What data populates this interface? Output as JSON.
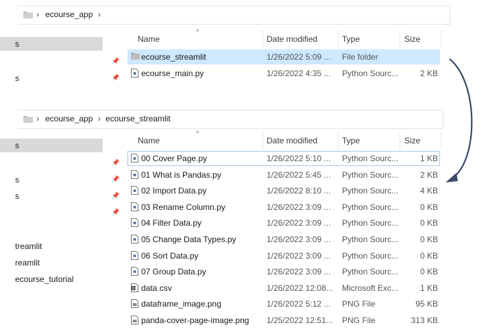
{
  "top": {
    "breadcrumb": [
      "ecourse_app"
    ],
    "columns": {
      "name": "Name",
      "date": "Date modified",
      "type": "Type",
      "size": "Size"
    },
    "sidebar": [
      {
        "label": "s",
        "selected": true
      },
      {
        "label": "",
        "pinned": true
      },
      {
        "label": "s",
        "pinned": true
      }
    ],
    "files": [
      {
        "name": "ecourse_streamlit",
        "date": "1/26/2022 5:09 ...",
        "type": "File folder",
        "size": "",
        "icon": "folder-icon",
        "selected": true
      },
      {
        "name": "ecourse_main.py",
        "date": "1/26/2022 4:35 ...",
        "type": "Python Sourc...",
        "size": "2 KB",
        "icon": "python-file-icon"
      }
    ]
  },
  "bottom": {
    "breadcrumb": [
      "ecourse_app",
      "ecourse_streamlit"
    ],
    "columns": {
      "name": "Name",
      "date": "Date modified",
      "type": "Type",
      "size": "Size"
    },
    "sidebar": [
      {
        "label": "s",
        "selected": true
      },
      {
        "label": "",
        "pinned": true
      },
      {
        "label": "s",
        "pinned": true
      },
      {
        "label": "s",
        "pinned": true
      },
      {
        "label": "",
        "pinned": true
      },
      {
        "label": ""
      },
      {
        "label": "treamlit"
      },
      {
        "label": "reamlit"
      },
      {
        "label": "ecourse_tutorial"
      }
    ],
    "files": [
      {
        "name": "00 Cover Page.py",
        "date": "1/26/2022 5:10 ...",
        "type": "Python Sourc...",
        "size": "1 KB",
        "icon": "python-file-icon",
        "focused": true
      },
      {
        "name": "01 What is Pandas.py",
        "date": "1/26/2022 5:45 ...",
        "type": "Python Sourc...",
        "size": "2 KB",
        "icon": "python-file-icon"
      },
      {
        "name": "02 Import Data.py",
        "date": "1/26/2022 8:10 ...",
        "type": "Python Sourc...",
        "size": "4 KB",
        "icon": "python-file-icon"
      },
      {
        "name": "03 Rename Column.py",
        "date": "1/26/2022 3:09 ...",
        "type": "Python Sourc...",
        "size": "0 KB",
        "icon": "python-file-icon"
      },
      {
        "name": "04 Filter Data.py",
        "date": "1/26/2022 3:09 ...",
        "type": "Python Sourc...",
        "size": "0 KB",
        "icon": "python-file-icon"
      },
      {
        "name": "05 Change Data Types.py",
        "date": "1/26/2022 3:09 ...",
        "type": "Python Sourc...",
        "size": "0 KB",
        "icon": "python-file-icon"
      },
      {
        "name": "06 Sort Data.py",
        "date": "1/26/2022 3:09 ...",
        "type": "Python Sourc...",
        "size": "0 KB",
        "icon": "python-file-icon"
      },
      {
        "name": "07 Group Data.py",
        "date": "1/26/2022 3:09 ...",
        "type": "Python Sourc...",
        "size": "0 KB",
        "icon": "python-file-icon"
      },
      {
        "name": "data.csv",
        "date": "1/26/2022 12:08...",
        "type": "Microsoft Exc...",
        "size": "1 KB",
        "icon": "excel-file-icon"
      },
      {
        "name": "dataframe_image.png",
        "date": "1/26/2022 5:12 ...",
        "type": "PNG File",
        "size": "95 KB",
        "icon": "image-file-icon"
      },
      {
        "name": "panda-cover-page-image.png",
        "date": "1/25/2022 12:51...",
        "type": "PNG File",
        "size": "313 KB",
        "icon": "image-file-icon"
      }
    ]
  },
  "colors": {
    "selection": "#cde8ff",
    "sidebar_selected": "#d9d9d9",
    "arrow": "#3a4a6a"
  }
}
